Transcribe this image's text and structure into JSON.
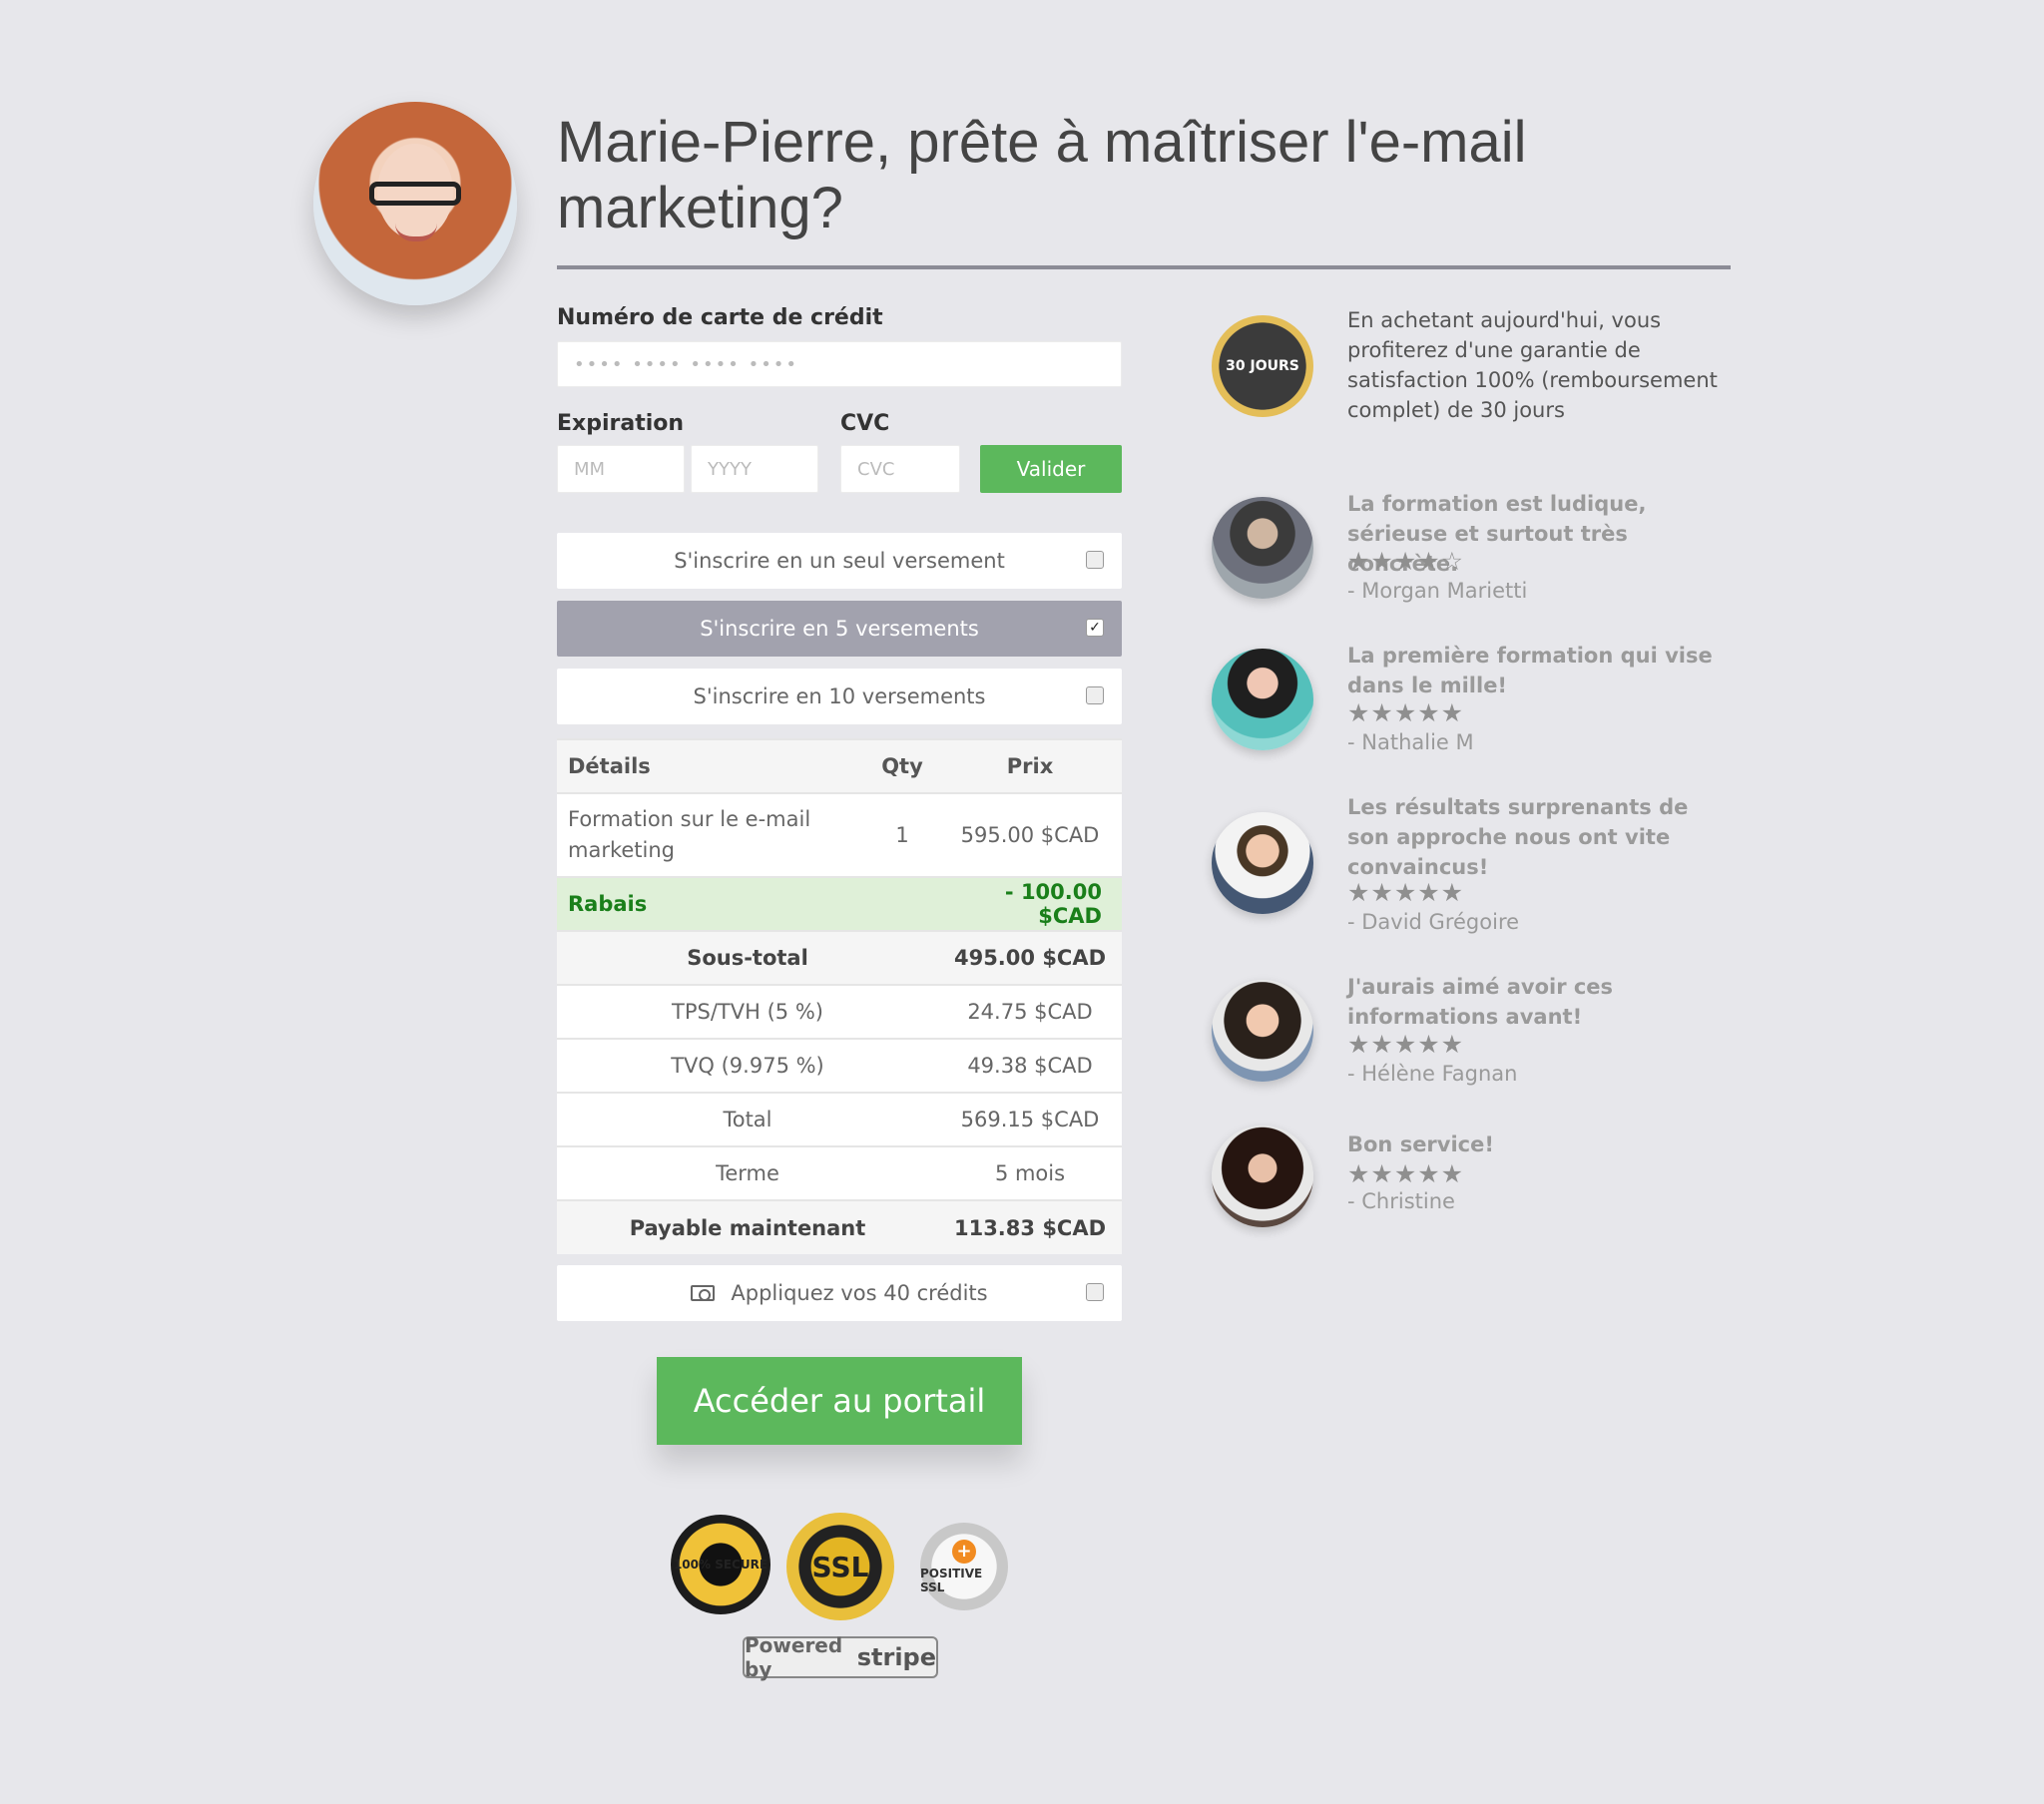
{
  "header": {
    "title": "Marie-Pierre, prête à maîtriser l'e-mail marketing?"
  },
  "payment": {
    "card_label": "Numéro de carte de crédit",
    "card_placeholder": "•••• •••• •••• ••••",
    "expiration_label": "Expiration",
    "cvc_label": "CVC",
    "month_placeholder": "MM",
    "year_placeholder": "YYYY",
    "cvc_placeholder": "CVC",
    "validate_label": "Valider"
  },
  "options": [
    {
      "label": "S'inscrire en un seul versement",
      "checked": false
    },
    {
      "label": "S'inscrire en 5 versements",
      "checked": true
    },
    {
      "label": "S'inscrire en 10 versements",
      "checked": false
    }
  ],
  "order": {
    "headers": [
      "Détails",
      "Qty",
      "Prix"
    ],
    "item": {
      "name": "Formation sur le e-mail marketing",
      "qty": "1",
      "price": "595.00 $CAD"
    },
    "discount": {
      "label": "Rabais",
      "value": "- 100.00 $CAD"
    },
    "subtotal": {
      "label": "Sous-total",
      "value": "495.00 $CAD"
    },
    "tps": {
      "label": "TPS/TVH (5 %)",
      "value": "24.75 $CAD"
    },
    "tvq": {
      "label": "TVQ (9.975 %)",
      "value": "49.38 $CAD"
    },
    "total": {
      "label": "Total",
      "value": "569.15 $CAD"
    },
    "term": {
      "label": "Terme",
      "value": "5 mois"
    },
    "due_now": {
      "label": "Payable maintenant",
      "value": "113.83 $CAD"
    }
  },
  "credits": {
    "label": "Appliquez vos 40 crédits",
    "checked": false
  },
  "cta": {
    "label": "Accéder au portail"
  },
  "badges": {
    "secure": "100% SECURE",
    "ssl": "SSL",
    "positive_ssl": "POSITIVE SSL",
    "stripe_prefix": "Powered by",
    "stripe_brand": "stripe"
  },
  "guarantee": {
    "badge": "30 JOURS",
    "text": "En achetant aujourd'hui, vous profiterez d'une garantie de satisfaction 100% (remboursement complet) de 30 jours"
  },
  "testimonials": [
    {
      "quote": "La formation est ludique, sérieuse et surtout très concrète.",
      "stars": "★★★★☆",
      "author": "- Morgan Marietti",
      "rating": 4.5
    },
    {
      "quote": "La première formation qui vise dans le mille!",
      "stars": "★★★★★",
      "author": "- Nathalie M",
      "rating": 5
    },
    {
      "quote": "Les résultats surprenants de son approche nous ont vite convaincus!",
      "stars": "★★★★★",
      "author": "- David Grégoire",
      "rating": 5
    },
    {
      "quote": "J'aurais aimé avoir ces informations avant!",
      "stars": "★★★★★",
      "author": "- Hélène Fagnan",
      "rating": 5
    },
    {
      "quote": "Bon service!",
      "stars": "★★★★★",
      "author": "- Christine",
      "rating": 5
    }
  ]
}
